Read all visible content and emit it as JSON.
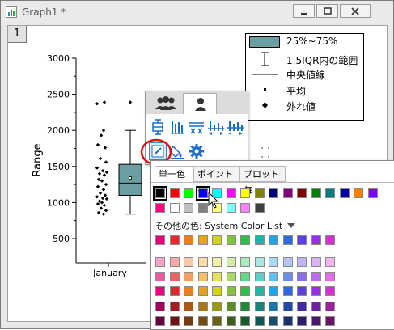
{
  "window": {
    "title": "Graph1 *",
    "layer_number": "1"
  },
  "chart_data": {
    "type": "box",
    "ylabel": "Range",
    "ylim": [
      500,
      3000
    ],
    "yticks": [
      500,
      1000,
      1500,
      2000,
      2500,
      3000
    ],
    "ytick_labels": [
      "500",
      "1000",
      "1500",
      "2000",
      "2500",
      "3000"
    ],
    "categories": [
      "January"
    ],
    "box": {
      "q1": 1100,
      "q3": 1530,
      "median": 1270,
      "mean": 1340,
      "whisker_low": 840,
      "whisker_high": 2000,
      "outliers": [
        2390
      ]
    },
    "points": [
      2390,
      2370,
      2000,
      1930,
      1800,
      1760,
      1610,
      1560,
      1480,
      1440,
      1420,
      1400,
      1380,
      1320,
      1300,
      1250,
      1220,
      1180,
      1130,
      1100,
      1080,
      1060,
      1050,
      1020,
      1000,
      980,
      960,
      920,
      890,
      860,
      840
    ]
  },
  "legend": {
    "items": [
      {
        "label": "25%~75%"
      },
      {
        "label": "1.5IQR内の範囲"
      },
      {
        "label": "中央値線"
      },
      {
        "label": "平均"
      },
      {
        "label": "外れ値"
      }
    ]
  },
  "mini_toolbar": {
    "tab_icons": [
      "group-icon",
      "person-icon"
    ]
  },
  "color_popup": {
    "tabs": [
      "単一色",
      "ポイント毎",
      "プロット毎"
    ],
    "other_colors_label": "その他の色: System Color List",
    "row1": [
      "#000000",
      "#ff0000",
      "#00ff00",
      "#0000ff",
      "#00ffff",
      "#ff00ff",
      "#ffff00",
      "#808000",
      "#000080",
      "#800080",
      "#800000",
      "#008000",
      "#008080",
      "#0000a0",
      "#ff8000",
      "#8000ff"
    ],
    "row2": [
      "#ff0080",
      "#ffffff",
      "#c0c0c0",
      "#808080",
      "#ffff80",
      "#80ffff",
      "#ff80ff",
      "#404040"
    ],
    "system_row": [
      "#e8007a",
      "#e8252f",
      "#ea7f22",
      "#eaa21d",
      "#d4d21c",
      "#82c23d",
      "#2fbe4e",
      "#1fb6a8",
      "#1ea4e8",
      "#2f6ae6",
      "#5a3ee6",
      "#9b2fe6",
      "#d72fd8"
    ],
    "grid": [
      [
        "#f6a5c8",
        "#f8a9a9",
        "#f8c9a9",
        "#f8dca9",
        "#f1efa9",
        "#d1eba9",
        "#a9ebbd",
        "#a9e6df",
        "#a9dbf6",
        "#b4c4f4",
        "#c1b4f4",
        "#dab4f4",
        "#f0b4f0"
      ],
      [
        "#ee5fa0",
        "#f06363",
        "#f29e63",
        "#f3c063",
        "#e6e260",
        "#a8d965",
        "#62d786",
        "#5fd0c5",
        "#5fbff0",
        "#6d8eee",
        "#8a6eee",
        "#bc6eee",
        "#e46ee4"
      ],
      [
        "#e8007a",
        "#e8252f",
        "#ea7f22",
        "#eaa21d",
        "#d4d21c",
        "#82c23d",
        "#2fbe4e",
        "#1fb6a8",
        "#1ea4e8",
        "#2f6ae6",
        "#5a3ee6",
        "#9b2fe6",
        "#d72fd8"
      ],
      [
        "#a0005a",
        "#a81a22",
        "#aa5a18",
        "#aa7515",
        "#999714",
        "#5e8c2c",
        "#218a38",
        "#16847a",
        "#1677a8",
        "#2249a6",
        "#3f2ba6",
        "#6f21a6",
        "#9c219c"
      ],
      [
        "#6a003c",
        "#701116",
        "#713c10",
        "#714e0e",
        "#66650d",
        "#3f5d1d",
        "#165c25",
        "#0f5851",
        "#0f4f70",
        "#16316e",
        "#2a1c6e",
        "#4a166e",
        "#681668"
      ]
    ],
    "selected_color": "#0000ff"
  }
}
